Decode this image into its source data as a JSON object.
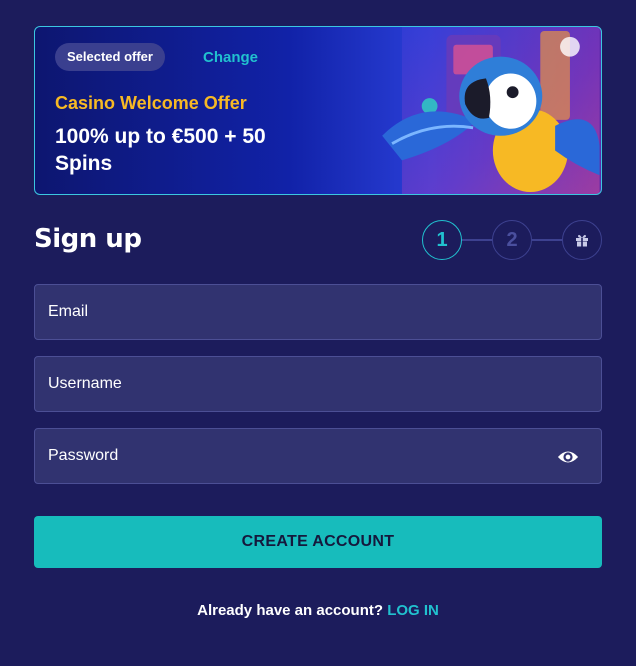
{
  "offer": {
    "badge": "Selected offer",
    "change_label": "Change",
    "title": "Casino Welcome Offer",
    "description": "100% up to €500 + 50 Spins"
  },
  "signup": {
    "title": "Sign up",
    "steps": [
      "1",
      "2"
    ],
    "step3_icon": "gift-icon"
  },
  "form": {
    "email_placeholder": "Email",
    "username_placeholder": "Username",
    "password_placeholder": "Password",
    "password_toggle_icon": "eye-icon",
    "submit_label": "CREATE ACCOUNT"
  },
  "footer": {
    "prompt": "Already have an account?",
    "login_label": "LOG IN"
  },
  "colors": {
    "background": "#1c1c5c",
    "accent": "#21c1cf",
    "offer_title": "#f7b924",
    "button": "#17bcbc"
  }
}
